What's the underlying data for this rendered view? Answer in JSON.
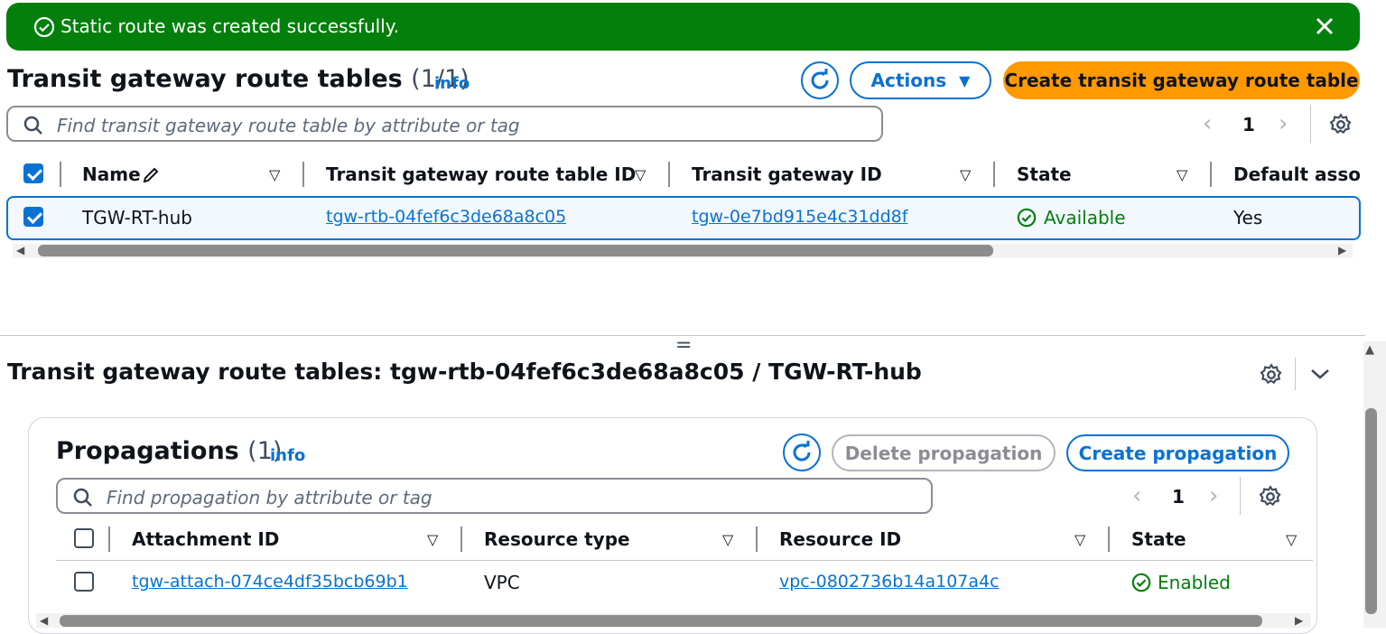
{
  "flash": {
    "message": "Static route was created successfully."
  },
  "route_tables": {
    "title": "Transit gateway route tables",
    "count": "(1/1)",
    "info": "info",
    "actions_label": "Actions",
    "create_label": "Create transit gateway route table",
    "search_placeholder": "Find transit gateway route table by attribute or tag",
    "page": "1",
    "columns": [
      "Name",
      "Transit gateway route table ID",
      "Transit gateway ID",
      "State",
      "Default associ"
    ],
    "rows": [
      {
        "name": "TGW-RT-hub",
        "rtb_id": "tgw-rtb-04fef6c3de68a8c05",
        "tgw_id": "tgw-0e7bd915e4c31dd8f",
        "state": "Available",
        "default_assoc": "Yes"
      }
    ]
  },
  "detail": {
    "title": "Transit gateway route tables: tgw-rtb-04fef6c3de68a8c05 / TGW-RT-hub"
  },
  "propagations": {
    "title": "Propagations",
    "count": "(1)",
    "info": "info",
    "delete_label": "Delete propagation",
    "create_label": "Create propagation",
    "search_placeholder": "Find propagation by attribute or tag",
    "page": "1",
    "columns": [
      "Attachment ID",
      "Resource type",
      "Resource ID",
      "State"
    ],
    "rows": [
      {
        "attachment_id": "tgw-attach-074ce4df35bcb69b1",
        "resource_type": "VPC",
        "resource_id": "vpc-0802736b14a107a4c",
        "state": "Enabled"
      }
    ]
  },
  "colors": {
    "success": "#037f0c",
    "link": "#0972d3",
    "primary": "#ff9900"
  }
}
